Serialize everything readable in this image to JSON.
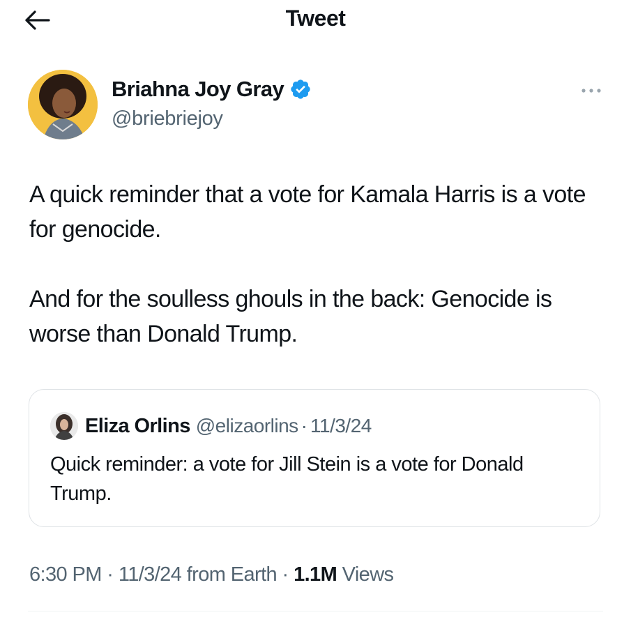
{
  "header": {
    "title": "Tweet",
    "back_icon": "arrow-left-icon"
  },
  "author": {
    "name": "Briahna Joy Gray",
    "handle": "@briebriejoy",
    "verified": true,
    "verified_color": "#1d9bf0",
    "avatar_bg": "#f3c040",
    "more_icon": "more-horizontal-icon"
  },
  "tweet": {
    "paragraphs": [
      "A quick reminder that a vote for Kamala Harris is a vote for genocide.",
      "And for the soulless ghouls in the back: Genocide is worse than Donald Trump."
    ]
  },
  "quote": {
    "name": "Eliza Orlins",
    "handle": "@elizaorlins",
    "separator": "·",
    "date": "11/3/24",
    "text": "Quick reminder: a vote for Jill Stein is a vote for Donald Trump."
  },
  "meta": {
    "time": "6:30 PM",
    "sep1": "·",
    "date": "11/3/24",
    "source": "from Earth",
    "sep2": "·",
    "views_count": "1.1M",
    "views_label": "Views"
  },
  "colors": {
    "text": "#0f1419",
    "secondary": "#536471",
    "accent": "#1d9bf0",
    "border": "#dfe3e6"
  }
}
